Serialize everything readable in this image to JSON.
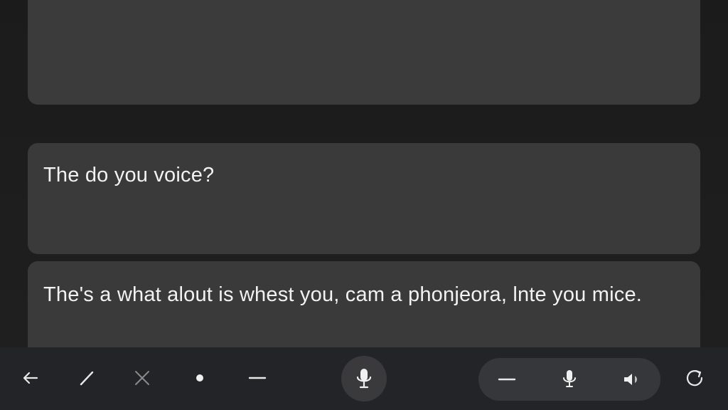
{
  "conversation": {
    "messages": [
      {
        "role": "empty",
        "text": ""
      },
      {
        "role": "message",
        "text": "The do you voice?"
      },
      {
        "role": "message",
        "text": "The's a what alout is whest you, cam a phonjeora, lnte you mice."
      }
    ]
  },
  "toolbar": {
    "left_icons": [
      "back-arrow-icon",
      "pen-icon",
      "close-icon",
      "dot-icon",
      "minus-icon"
    ],
    "center_icon": "microphone-icon",
    "pill_icons": [
      "minus-icon",
      "microphone-icon",
      "speaker-icon"
    ],
    "right_icon": "refresh-icon"
  },
  "colors": {
    "background": "#1c1c1c",
    "card": "#3a3a3a",
    "toolbar": "#232427",
    "pill": "#36373a",
    "text": "#f2f2f2",
    "muted_icon": "#8a8a8a"
  }
}
